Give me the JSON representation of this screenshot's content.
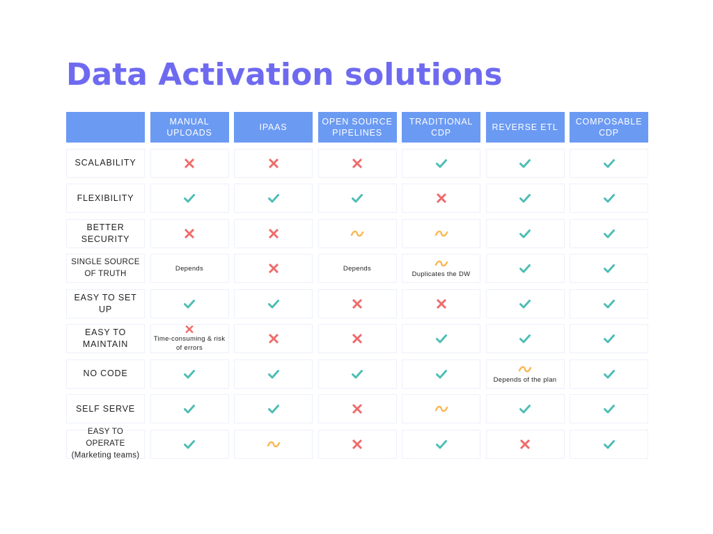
{
  "title": "Data Activation solutions",
  "colors": {
    "title": "#6e6af0",
    "header_bg": "#6b9af3",
    "check": "#4dbdb5",
    "cross": "#ef6b6b",
    "partial": "#f9b856"
  },
  "columns": [
    "",
    "MANUAL UPLOADS",
    "IPAAS",
    "OPEN SOURCE PIPELINES",
    "TRADITIONAL CDP",
    "REVERSE ETL",
    "COMPOSABLE CDP"
  ],
  "rows": [
    {
      "label": "SCALABILITY",
      "cells": [
        {
          "icon": "cross"
        },
        {
          "icon": "cross"
        },
        {
          "icon": "cross"
        },
        {
          "icon": "check"
        },
        {
          "icon": "check"
        },
        {
          "icon": "check"
        }
      ]
    },
    {
      "label": "FLEXIBILITY",
      "cells": [
        {
          "icon": "check"
        },
        {
          "icon": "check"
        },
        {
          "icon": "check"
        },
        {
          "icon": "cross"
        },
        {
          "icon": "check"
        },
        {
          "icon": "check"
        }
      ]
    },
    {
      "label": "BETTER SECURITY",
      "cells": [
        {
          "icon": "cross"
        },
        {
          "icon": "cross"
        },
        {
          "icon": "partial"
        },
        {
          "icon": "partial"
        },
        {
          "icon": "check"
        },
        {
          "icon": "check"
        }
      ]
    },
    {
      "label": "SINGLE SOURCE OF TRUTH",
      "cells": [
        {
          "icon": "",
          "note": "Depends"
        },
        {
          "icon": "cross"
        },
        {
          "icon": "",
          "note": "Depends"
        },
        {
          "icon": "partial",
          "note": "Duplicates the DW"
        },
        {
          "icon": "check"
        },
        {
          "icon": "check"
        }
      ]
    },
    {
      "label": "EASY TO SET UP",
      "cells": [
        {
          "icon": "check"
        },
        {
          "icon": "check"
        },
        {
          "icon": "cross"
        },
        {
          "icon": "cross"
        },
        {
          "icon": "check"
        },
        {
          "icon": "check"
        }
      ]
    },
    {
      "label": "EASY TO MAINTAIN",
      "cells": [
        {
          "icon": "cross",
          "note": "Time-consuming & risk of errors"
        },
        {
          "icon": "cross"
        },
        {
          "icon": "cross"
        },
        {
          "icon": "check"
        },
        {
          "icon": "check"
        },
        {
          "icon": "check"
        }
      ]
    },
    {
      "label": "NO CODE",
      "cells": [
        {
          "icon": "check"
        },
        {
          "icon": "check"
        },
        {
          "icon": "check"
        },
        {
          "icon": "check"
        },
        {
          "icon": "partial",
          "note": "Depends of the plan"
        },
        {
          "icon": "check"
        }
      ]
    },
    {
      "label": "SELF SERVE",
      "cells": [
        {
          "icon": "check"
        },
        {
          "icon": "check"
        },
        {
          "icon": "cross"
        },
        {
          "icon": "partial"
        },
        {
          "icon": "check"
        },
        {
          "icon": "check"
        }
      ]
    },
    {
      "label": "EASY TO OPERATE (Marketing teams)",
      "cells": [
        {
          "icon": "check"
        },
        {
          "icon": "partial"
        },
        {
          "icon": "cross"
        },
        {
          "icon": "check"
        },
        {
          "icon": "cross"
        },
        {
          "icon": "check"
        }
      ]
    }
  ]
}
